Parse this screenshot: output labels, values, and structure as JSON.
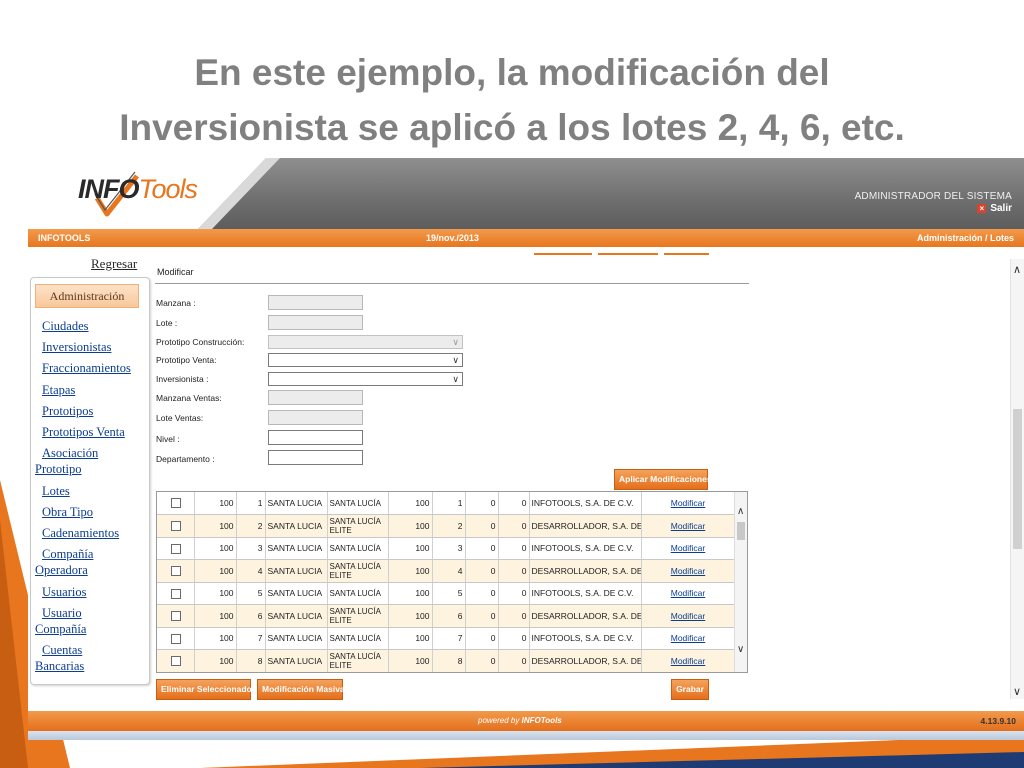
{
  "slide": {
    "title_line1": "En este ejemplo, la modificación del",
    "title_line2": "Inversionista se aplicó a los lotes 2, 4, 6, etc."
  },
  "app": {
    "logo_info": "INFO",
    "logo_tools": "Tools",
    "admin_label": "ADMINISTRADOR DEL SISTEMA",
    "logout_label": "Salir",
    "bar_left": "INFOTOOLS",
    "bar_center": "19/nov./2013",
    "bar_right": "Administración / Lotes",
    "accent_color": "#e8761e"
  },
  "nav": {
    "back_label": "Regresar",
    "header": "Administración",
    "items": [
      {
        "line1": "Ciudades",
        "line2": ""
      },
      {
        "line1": "Inversionistas",
        "line2": ""
      },
      {
        "line1": "Fraccionamientos",
        "line2": ""
      },
      {
        "line1": "Etapas",
        "line2": ""
      },
      {
        "line1": "Prototipos",
        "line2": ""
      },
      {
        "line1": "Prototipos Venta",
        "line2": ""
      },
      {
        "line1": "Asociación",
        "line2": "Prototipo"
      },
      {
        "line1": "Lotes",
        "line2": ""
      },
      {
        "line1": "Obra Tipo",
        "line2": ""
      },
      {
        "line1": "Cadenamientos",
        "line2": ""
      },
      {
        "line1": "Compañía",
        "line2": "Operadora"
      },
      {
        "line1": "Usuarios",
        "line2": ""
      },
      {
        "line1": "Usuario",
        "line2": "Compañía"
      },
      {
        "line1": "Cuentas",
        "line2": "Bancarias"
      }
    ]
  },
  "form": {
    "section_label": "Modificar",
    "manzana_label": "Manzana :",
    "lote_label": "Lote :",
    "prototipo_construccion_label": "Prototipo Construcción:",
    "prototipo_venta_label": "Prototipo Venta:",
    "inversionista_label": "Inversionista :",
    "manzana_ventas_label": "Manzana Ventas:",
    "lote_ventas_label": "Lote Ventas:",
    "nivel_label": "Nivel :",
    "departamento_label": "Departamento :",
    "apply_button": "Aplicar Modificaciones"
  },
  "table": {
    "rows": [
      {
        "manzana": "100",
        "lote": "1",
        "proto_const": "SANTA LUCIA",
        "proto_venta": "SANTA LUCÍA",
        "manzana_v": "100",
        "lote_v": "1",
        "nivel": "0",
        "depto": "0",
        "inversionista": "INFOTOOLS, S.A. DE C.V.",
        "action": "Modificar"
      },
      {
        "manzana": "100",
        "lote": "2",
        "proto_const": "SANTA LUCIA",
        "proto_venta": "SANTA LUCÍA ELITE",
        "manzana_v": "100",
        "lote_v": "2",
        "nivel": "0",
        "depto": "0",
        "inversionista": "DESARROLLADOR, S.A. DE C.V.",
        "action": "Modificar"
      },
      {
        "manzana": "100",
        "lote": "3",
        "proto_const": "SANTA LUCIA",
        "proto_venta": "SANTA LUCÍA",
        "manzana_v": "100",
        "lote_v": "3",
        "nivel": "0",
        "depto": "0",
        "inversionista": "INFOTOOLS, S.A. DE C.V.",
        "action": "Modificar"
      },
      {
        "manzana": "100",
        "lote": "4",
        "proto_const": "SANTA LUCIA",
        "proto_venta": "SANTA LUCÍA ELITE",
        "manzana_v": "100",
        "lote_v": "4",
        "nivel": "0",
        "depto": "0",
        "inversionista": "DESARROLLADOR, S.A. DE C.V.",
        "action": "Modificar"
      },
      {
        "manzana": "100",
        "lote": "5",
        "proto_const": "SANTA LUCIA",
        "proto_venta": "SANTA LUCÍA",
        "manzana_v": "100",
        "lote_v": "5",
        "nivel": "0",
        "depto": "0",
        "inversionista": "INFOTOOLS, S.A. DE C.V.",
        "action": "Modificar"
      },
      {
        "manzana": "100",
        "lote": "6",
        "proto_const": "SANTA LUCIA",
        "proto_venta": "SANTA LUCÍA ELITE",
        "manzana_v": "100",
        "lote_v": "6",
        "nivel": "0",
        "depto": "0",
        "inversionista": "DESARROLLADOR, S.A. DE C.V.",
        "action": "Modificar"
      },
      {
        "manzana": "100",
        "lote": "7",
        "proto_const": "SANTA LUCIA",
        "proto_venta": "SANTA LUCÍA",
        "manzana_v": "100",
        "lote_v": "7",
        "nivel": "0",
        "depto": "0",
        "inversionista": "INFOTOOLS, S.A. DE C.V.",
        "action": "Modificar"
      },
      {
        "manzana": "100",
        "lote": "8",
        "proto_const": "SANTA LUCIA",
        "proto_venta": "SANTA LUCÍA ELITE",
        "manzana_v": "100",
        "lote_v": "8",
        "nivel": "0",
        "depto": "0",
        "inversionista": "DESARROLLADOR, S.A. DE C.V.",
        "action": "Modificar"
      }
    ]
  },
  "actions": {
    "delete_selected": "Eliminar Seleccionados",
    "mass_edit": "Modificación Masiva",
    "save": "Grabar"
  },
  "footer": {
    "powered_by": "powered by",
    "brand": "INFOTools",
    "version": "4.13.9.10"
  }
}
